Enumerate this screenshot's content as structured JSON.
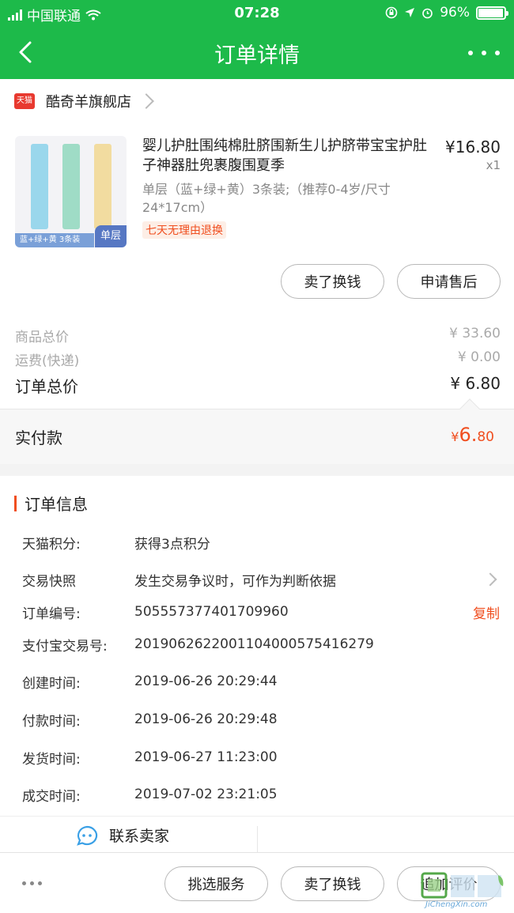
{
  "status_bar": {
    "carrier": "中国联通",
    "time": "07:28",
    "battery": "96%",
    "battery_level": 0.96
  },
  "header": {
    "title": "订单详情",
    "back_icon": "chevron-left-icon",
    "more_icon": "more-dots-icon"
  },
  "shop": {
    "badge": "天猫",
    "name": "酷奇羊旗舰店"
  },
  "product": {
    "title": "婴儿护肚围纯棉肚脐围新生儿护脐带宝宝护肚子神器肚兜裹腹围夏季",
    "price": "¥16.80",
    "qty": "x1",
    "sku": "单层（蓝+绿+黄）3条装;（推荐0-4岁/尺寸24*17cm）",
    "tag": "七天无理由退换",
    "thumb_caption": "蓝+绿+黄 3条装",
    "thumb_tag": "单层",
    "strip_colors": [
      "#9ad7ec",
      "#9fdcc6",
      "#f2dca0"
    ]
  },
  "actions": {
    "sell": "卖了换钱",
    "after_sale": "申请售后"
  },
  "summary": {
    "goods_label": "商品总价",
    "goods_value": "¥ 33.60",
    "shipping_label": "运费(快递)",
    "shipping_value": "¥ 0.00",
    "total_label": "订单总价",
    "total_value": "¥ 6.80",
    "paid_label": "实付款",
    "paid_currency": "¥",
    "paid_int": "6.",
    "paid_dec": "80"
  },
  "order_info": {
    "title": "订单信息",
    "points_label": "天猫积分:",
    "points_value": "获得3点积分",
    "snapshot_label": "交易快照",
    "snapshot_value": "发生交易争议时，可作为判断依据",
    "order_no_label": "订单编号:",
    "order_no_value": "505557377401709960",
    "copy": "复制",
    "alipay_label": "支付宝交易号:",
    "alipay_value": "2019062622001104000575416279",
    "created_label": "创建时间:",
    "created_value": "2019-06-26 20:29:44",
    "paid_time_label": "付款时间:",
    "paid_time_value": "2019-06-26 20:29:48",
    "shipped_label": "发货时间:",
    "shipped_value": "2019-06-27 11:23:00",
    "completed_label": "成交时间:",
    "completed_value": "2019-07-02 23:21:05"
  },
  "contact": {
    "label": "联系卖家"
  },
  "bottom_bar": {
    "pick_service": "挑选服务",
    "sell": "卖了换钱",
    "review": "追加评价"
  },
  "watermark": {
    "text": "JiChengXin.com"
  },
  "colors": {
    "brand_green": "#1dba4a",
    "accent_orange": "#f04e1f"
  }
}
